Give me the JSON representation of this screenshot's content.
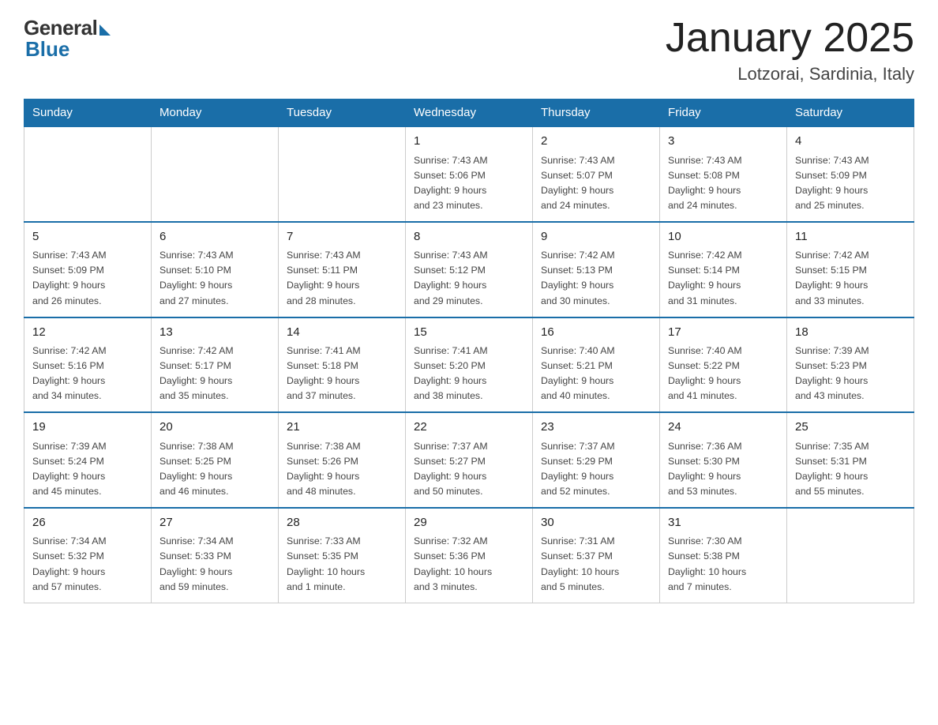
{
  "header": {
    "title": "January 2025",
    "subtitle": "Lotzorai, Sardinia, Italy",
    "logo_general": "General",
    "logo_blue": "Blue"
  },
  "weekdays": [
    "Sunday",
    "Monday",
    "Tuesday",
    "Wednesday",
    "Thursday",
    "Friday",
    "Saturday"
  ],
  "weeks": [
    [
      {
        "day": "",
        "info": ""
      },
      {
        "day": "",
        "info": ""
      },
      {
        "day": "",
        "info": ""
      },
      {
        "day": "1",
        "info": "Sunrise: 7:43 AM\nSunset: 5:06 PM\nDaylight: 9 hours\nand 23 minutes."
      },
      {
        "day": "2",
        "info": "Sunrise: 7:43 AM\nSunset: 5:07 PM\nDaylight: 9 hours\nand 24 minutes."
      },
      {
        "day": "3",
        "info": "Sunrise: 7:43 AM\nSunset: 5:08 PM\nDaylight: 9 hours\nand 24 minutes."
      },
      {
        "day": "4",
        "info": "Sunrise: 7:43 AM\nSunset: 5:09 PM\nDaylight: 9 hours\nand 25 minutes."
      }
    ],
    [
      {
        "day": "5",
        "info": "Sunrise: 7:43 AM\nSunset: 5:09 PM\nDaylight: 9 hours\nand 26 minutes."
      },
      {
        "day": "6",
        "info": "Sunrise: 7:43 AM\nSunset: 5:10 PM\nDaylight: 9 hours\nand 27 minutes."
      },
      {
        "day": "7",
        "info": "Sunrise: 7:43 AM\nSunset: 5:11 PM\nDaylight: 9 hours\nand 28 minutes."
      },
      {
        "day": "8",
        "info": "Sunrise: 7:43 AM\nSunset: 5:12 PM\nDaylight: 9 hours\nand 29 minutes."
      },
      {
        "day": "9",
        "info": "Sunrise: 7:42 AM\nSunset: 5:13 PM\nDaylight: 9 hours\nand 30 minutes."
      },
      {
        "day": "10",
        "info": "Sunrise: 7:42 AM\nSunset: 5:14 PM\nDaylight: 9 hours\nand 31 minutes."
      },
      {
        "day": "11",
        "info": "Sunrise: 7:42 AM\nSunset: 5:15 PM\nDaylight: 9 hours\nand 33 minutes."
      }
    ],
    [
      {
        "day": "12",
        "info": "Sunrise: 7:42 AM\nSunset: 5:16 PM\nDaylight: 9 hours\nand 34 minutes."
      },
      {
        "day": "13",
        "info": "Sunrise: 7:42 AM\nSunset: 5:17 PM\nDaylight: 9 hours\nand 35 minutes."
      },
      {
        "day": "14",
        "info": "Sunrise: 7:41 AM\nSunset: 5:18 PM\nDaylight: 9 hours\nand 37 minutes."
      },
      {
        "day": "15",
        "info": "Sunrise: 7:41 AM\nSunset: 5:20 PM\nDaylight: 9 hours\nand 38 minutes."
      },
      {
        "day": "16",
        "info": "Sunrise: 7:40 AM\nSunset: 5:21 PM\nDaylight: 9 hours\nand 40 minutes."
      },
      {
        "day": "17",
        "info": "Sunrise: 7:40 AM\nSunset: 5:22 PM\nDaylight: 9 hours\nand 41 minutes."
      },
      {
        "day": "18",
        "info": "Sunrise: 7:39 AM\nSunset: 5:23 PM\nDaylight: 9 hours\nand 43 minutes."
      }
    ],
    [
      {
        "day": "19",
        "info": "Sunrise: 7:39 AM\nSunset: 5:24 PM\nDaylight: 9 hours\nand 45 minutes."
      },
      {
        "day": "20",
        "info": "Sunrise: 7:38 AM\nSunset: 5:25 PM\nDaylight: 9 hours\nand 46 minutes."
      },
      {
        "day": "21",
        "info": "Sunrise: 7:38 AM\nSunset: 5:26 PM\nDaylight: 9 hours\nand 48 minutes."
      },
      {
        "day": "22",
        "info": "Sunrise: 7:37 AM\nSunset: 5:27 PM\nDaylight: 9 hours\nand 50 minutes."
      },
      {
        "day": "23",
        "info": "Sunrise: 7:37 AM\nSunset: 5:29 PM\nDaylight: 9 hours\nand 52 minutes."
      },
      {
        "day": "24",
        "info": "Sunrise: 7:36 AM\nSunset: 5:30 PM\nDaylight: 9 hours\nand 53 minutes."
      },
      {
        "day": "25",
        "info": "Sunrise: 7:35 AM\nSunset: 5:31 PM\nDaylight: 9 hours\nand 55 minutes."
      }
    ],
    [
      {
        "day": "26",
        "info": "Sunrise: 7:34 AM\nSunset: 5:32 PM\nDaylight: 9 hours\nand 57 minutes."
      },
      {
        "day": "27",
        "info": "Sunrise: 7:34 AM\nSunset: 5:33 PM\nDaylight: 9 hours\nand 59 minutes."
      },
      {
        "day": "28",
        "info": "Sunrise: 7:33 AM\nSunset: 5:35 PM\nDaylight: 10 hours\nand 1 minute."
      },
      {
        "day": "29",
        "info": "Sunrise: 7:32 AM\nSunset: 5:36 PM\nDaylight: 10 hours\nand 3 minutes."
      },
      {
        "day": "30",
        "info": "Sunrise: 7:31 AM\nSunset: 5:37 PM\nDaylight: 10 hours\nand 5 minutes."
      },
      {
        "day": "31",
        "info": "Sunrise: 7:30 AM\nSunset: 5:38 PM\nDaylight: 10 hours\nand 7 minutes."
      },
      {
        "day": "",
        "info": ""
      }
    ]
  ]
}
